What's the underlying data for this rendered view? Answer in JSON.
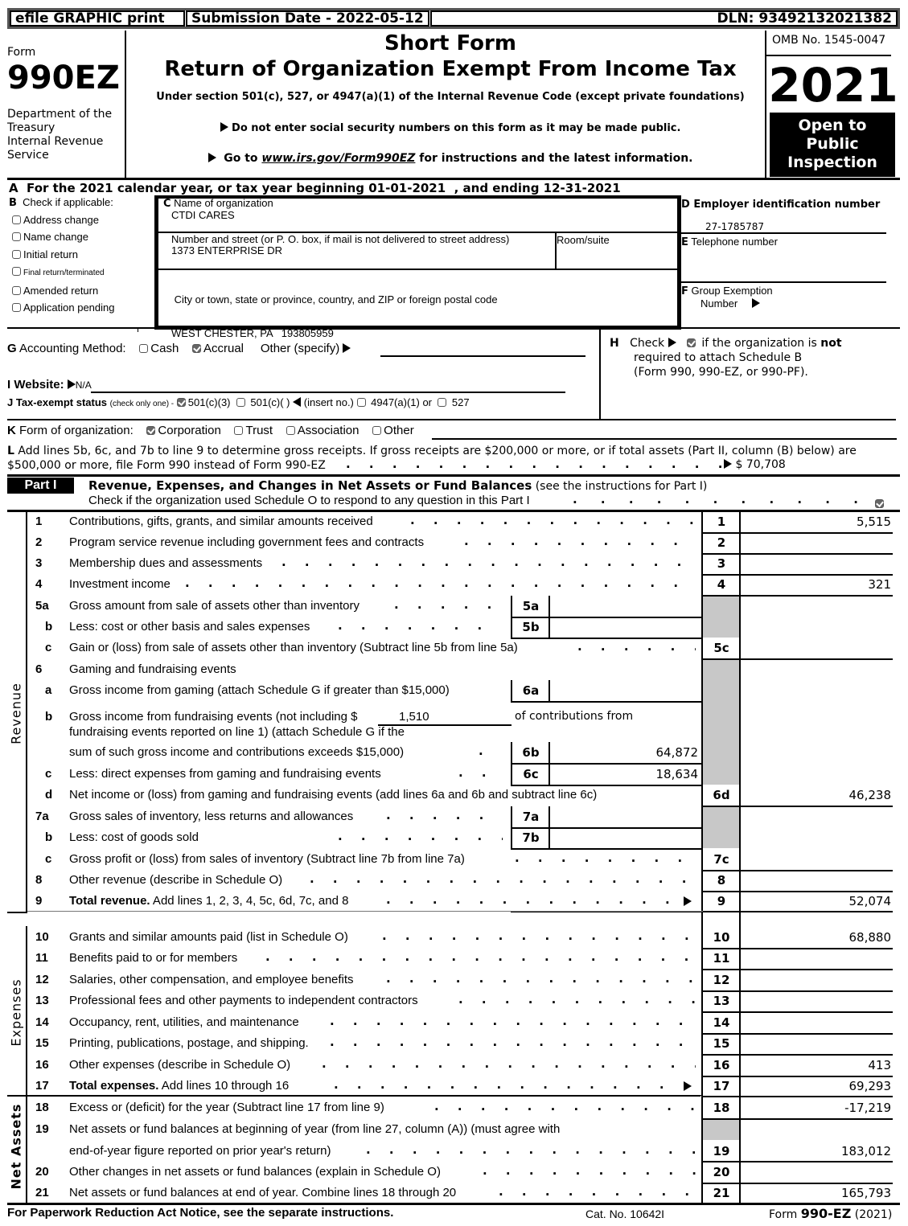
{
  "topbar": {
    "efile": "efile GRAPHIC print",
    "submission": "Submission Date - 2022-05-12",
    "dln": "DLN: 93492132021382"
  },
  "header": {
    "form_label": "Form",
    "form_number": "990EZ",
    "dept1": "Department of the",
    "dept2": "Treasury",
    "dept3": "Internal Revenue",
    "dept4": "Service",
    "title1": "Short Form",
    "title2": "Return of Organization Exempt From Income Tax",
    "subtitle": "Under section 501(c), 527, or 4947(a)(1) of the Internal Revenue Code (except private foundations)",
    "notice1": "Do not enter social security numbers on this form as it may be made public.",
    "notice2_pre": "Go to ",
    "notice2_link": "www.irs.gov/Form990EZ",
    "notice2_post": " for instructions and the latest information.",
    "omb": "OMB No. 1545-0047",
    "year": "2021",
    "open1": "Open to",
    "open2": "Public",
    "open3": "Inspection"
  },
  "lineA": "A  For the 2021 calendar year, or tax year beginning 01-01-2021  , and ending 12-31-2021",
  "sectionB": {
    "label": "B",
    "title": "Check if applicable:",
    "items": [
      {
        "label": "Address change",
        "checked": false
      },
      {
        "label": "Name change",
        "checked": false
      },
      {
        "label": "Initial return",
        "checked": false
      },
      {
        "label": "Final return/terminated",
        "checked": false
      },
      {
        "label": "Amended return",
        "checked": false
      },
      {
        "label": "Application pending",
        "checked": false
      }
    ]
  },
  "sectionC": {
    "name_label_c": "C",
    "name_label": " Name of organization",
    "name": "CTDI CARES",
    "street_label": "Number and street (or P. O. box, if mail is not delivered to street address)",
    "street": "1373 ENTERPRISE DR",
    "room_label": "Room/suite",
    "room": "",
    "city_label": " City or town, state or province, country, and ZIP or foreign postal code",
    "city": "WEST CHESTER, PA   193805959"
  },
  "sectionD": {
    "label": "D Employer identification number",
    "ein": "27-1785787",
    "tel_label_e": "E",
    "tel_label": " Telephone number",
    "tel": "",
    "group_label_f": "F",
    "group_label1": " Group Exemption",
    "group_label2": "Number"
  },
  "sectionG": {
    "label_g": "G",
    "label": " Accounting Method:",
    "cash": "Cash",
    "cash_checked": false,
    "accrual": "Accrual",
    "accrual_checked": true,
    "other": "Other (specify)",
    "other_value": ""
  },
  "sectionH": {
    "label": "H",
    "check": "Check",
    "checked": true,
    "text1": " if the organization is ",
    "text_not": "not",
    "text2": "required to attach Schedule B",
    "text3": "(Form 990, 990-EZ, or 990-PF)."
  },
  "sectionI": {
    "label": "I Website:",
    "value": "N/A"
  },
  "sectionJ": {
    "label": "J Tax-exempt status",
    "note": "(check only one) -",
    "opt1": "501(c)(3)",
    "opt1_checked": true,
    "opt2": "501(c)(   )",
    "opt2_note": "(insert no.)",
    "opt3": "4947(a)(1) or",
    "opt4": "527"
  },
  "sectionK": {
    "label_k": "K",
    "label": " Form of organization:",
    "options": [
      {
        "label": "Corporation",
        "checked": true
      },
      {
        "label": "Trust",
        "checked": false
      },
      {
        "label": "Association",
        "checked": false
      },
      {
        "label": "Other",
        "checked": false
      }
    ]
  },
  "sectionL": {
    "label_l": "L",
    "text1": " Add lines 5b, 6c, and 7b to line 9 to determine gross receipts. If gross receipts are $200,000 or more, or if total assets (Part II, column (B) below) are",
    "text2": "$500,000 or more, file Form 990 instead of Form 990-EZ",
    "amount": "$ 70,708"
  },
  "part1": {
    "badge": "Part I",
    "title": "Revenue, Expenses, and Changes in Net Assets or Fund Balances",
    "title_note": " (see the instructions for Part I)",
    "schedule_o": "Check if the organization used Schedule O to respond to any question in this Part I",
    "schedule_o_checked": true,
    "side_revenue": "Revenue",
    "side_expenses": "Expenses",
    "side_net": "Net Assets",
    "lines": {
      "l1": {
        "num": "1",
        "text": "Contributions, gifts, grants, and similar amounts received",
        "col": "1",
        "value": "5,515"
      },
      "l2": {
        "num": "2",
        "text": "Program service revenue including government fees and contracts",
        "col": "2",
        "value": ""
      },
      "l3": {
        "num": "3",
        "text": "Membership dues and assessments",
        "col": "3",
        "value": ""
      },
      "l4": {
        "num": "4",
        "text": "Investment income",
        "col": "4",
        "value": "321"
      },
      "l5a": {
        "num": "5a",
        "text": "Gross amount from sale of assets other than inventory",
        "col": "5a",
        "value": ""
      },
      "l5b": {
        "num": "b",
        "text": "Less: cost or other basis and sales expenses",
        "col": "5b",
        "value": ""
      },
      "l5c": {
        "num": "c",
        "text": "Gain or (loss) from sale of assets other than inventory (Subtract line 5b from line 5a)",
        "col": "5c",
        "value": ""
      },
      "l6": {
        "num": "6",
        "text": "Gaming and fundraising events"
      },
      "l6a": {
        "num": "a",
        "text": "Gross income from gaming (attach Schedule G if greater than $15,000)",
        "col": "6a",
        "value": ""
      },
      "l6b": {
        "num": "b",
        "text1": "Gross income from fundraising events (not including $",
        "inline_value": "1,510",
        "text2": "of contributions from",
        "text3": "fundraising events reported on line 1) (attach Schedule G if the",
        "text4": "sum of such gross income and contributions exceeds $15,000)",
        "col": "6b",
        "value": "64,872"
      },
      "l6c": {
        "num": "c",
        "text": "Less: direct expenses from gaming and fundraising events",
        "col": "6c",
        "value": "18,634"
      },
      "l6d": {
        "num": "d",
        "text": "Net income or (loss) from gaming and fundraising events (add lines 6a and 6b and subtract line 6c)",
        "col": "6d",
        "value": "46,238"
      },
      "l7a": {
        "num": "7a",
        "text": "Gross sales of inventory, less returns and allowances",
        "col": "7a",
        "value": ""
      },
      "l7b": {
        "num": "b",
        "text": "Less: cost of goods sold",
        "col": "7b",
        "value": ""
      },
      "l7c": {
        "num": "c",
        "text": "Gross profit or (loss) from sales of inventory (Subtract line 7b from line 7a)",
        "col": "7c",
        "value": ""
      },
      "l8": {
        "num": "8",
        "text": "Other revenue (describe in Schedule O)",
        "col": "8",
        "value": ""
      },
      "l9": {
        "num": "9",
        "text_bold": "Total revenue.",
        "text": " Add lines 1, 2, 3, 4, 5c, 6d, 7c, and 8",
        "col": "9",
        "value": "52,074"
      },
      "l10": {
        "num": "10",
        "text": "Grants and similar amounts paid (list in Schedule O)",
        "col": "10",
        "value": "68,880"
      },
      "l11": {
        "num": "11",
        "text": "Benefits paid to or for members",
        "col": "11",
        "value": ""
      },
      "l12": {
        "num": "12",
        "text": "Salaries, other compensation, and employee benefits",
        "col": "12",
        "value": ""
      },
      "l13": {
        "num": "13",
        "text": "Professional fees and other payments to independent contractors",
        "col": "13",
        "value": ""
      },
      "l14": {
        "num": "14",
        "text": "Occupancy, rent, utilities, and maintenance",
        "col": "14",
        "value": ""
      },
      "l15": {
        "num": "15",
        "text": "Printing, publications, postage, and shipping.",
        "col": "15",
        "value": ""
      },
      "l16": {
        "num": "16",
        "text": "Other expenses (describe in Schedule O)",
        "col": "16",
        "value": "413"
      },
      "l17": {
        "num": "17",
        "text_bold": "Total expenses.",
        "text": " Add lines 10 through 16",
        "col": "17",
        "value": "69,293"
      },
      "l18": {
        "num": "18",
        "text": "Excess or (deficit) for the year (Subtract line 17 from line 9)",
        "col": "18",
        "value": "-17,219"
      },
      "l19": {
        "num": "19",
        "text1": "Net assets or fund balances at beginning of year (from line 27, column (A)) (must agree with",
        "text2": "end-of-year figure reported on prior year's return)",
        "col": "19",
        "value": "183,012"
      },
      "l20": {
        "num": "20",
        "text": "Other changes in net assets or fund balances (explain in Schedule O)",
        "col": "20",
        "value": ""
      },
      "l21": {
        "num": "21",
        "text": "Net assets or fund balances at end of year. Combine lines 18 through 20",
        "col": "21",
        "value": "165,793"
      }
    }
  },
  "footer": {
    "notice": "For Paperwork Reduction Act Notice, see the separate instructions.",
    "cat": "Cat. No. 10642I",
    "form_pre": "Form ",
    "form_bold": "990-EZ",
    "form_post": " (2021)"
  }
}
